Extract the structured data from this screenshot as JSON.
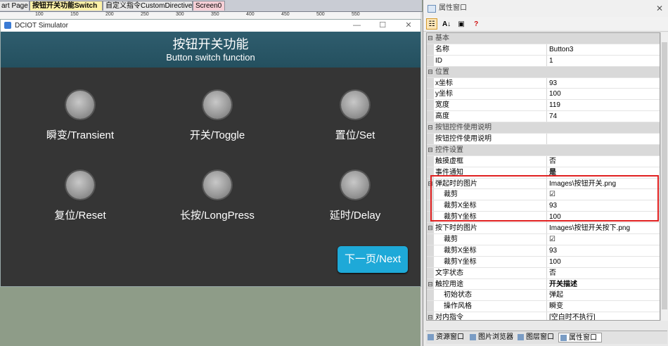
{
  "tabs": [
    {
      "label": "art Page"
    },
    {
      "label": "按钮开关功能Switch"
    },
    {
      "label": "自定义指令CustomDirectives"
    },
    {
      "label": "Screen0"
    }
  ],
  "ruler": [
    "100",
    "150",
    "200",
    "250",
    "300",
    "350",
    "400",
    "450",
    "500",
    "550"
  ],
  "simulator": {
    "title": "DCIOT Simulator",
    "min": "—",
    "max": "☐",
    "close": "✕",
    "header_title": "按钮开关功能",
    "header_subtitle": "Button switch function",
    "buttons": [
      {
        "label": "瞬变/Transient"
      },
      {
        "label": "开关/Toggle"
      },
      {
        "label": "置位/Set"
      },
      {
        "label": "复位/Reset"
      },
      {
        "label": "长按/LongPress"
      },
      {
        "label": "延时/Delay"
      }
    ],
    "next_label": "下一页/Next"
  },
  "panel": {
    "title": "属性窗口",
    "close": "✕",
    "toolbar": {
      "categorized": "☷",
      "alpha": "A↓",
      "pages": "▣",
      "help": "?"
    },
    "rows": [
      {
        "type": "cat",
        "name": "基本"
      },
      {
        "type": "prop",
        "name": "名称",
        "value": "Button3"
      },
      {
        "type": "prop",
        "name": "ID",
        "value": "1"
      },
      {
        "type": "cat",
        "name": "位置"
      },
      {
        "type": "prop",
        "name": "x坐标",
        "value": "93"
      },
      {
        "type": "prop",
        "name": "y坐标",
        "value": "100"
      },
      {
        "type": "prop",
        "name": "宽度",
        "value": "119"
      },
      {
        "type": "prop",
        "name": "高度",
        "value": "74"
      },
      {
        "type": "cat",
        "name": "按钮控件使用说明"
      },
      {
        "type": "prop",
        "name": "按钮控件使用说明",
        "value": ""
      },
      {
        "type": "cat",
        "name": "控件设置"
      },
      {
        "type": "prop",
        "name": "触摸虚框",
        "value": "否"
      },
      {
        "type": "prop",
        "name": "事件通知",
        "value": "是",
        "bold": true
      },
      {
        "type": "group",
        "name": "弹起时的图片",
        "value": "Images\\按钮开关.png"
      },
      {
        "type": "sub",
        "name": "裁剪",
        "value": "☑"
      },
      {
        "type": "sub",
        "name": "裁剪X坐标",
        "value": "93"
      },
      {
        "type": "sub",
        "name": "裁剪Y坐标",
        "value": "100"
      },
      {
        "type": "group",
        "name": "按下时的图片",
        "value": "Images\\按钮开关按下.png"
      },
      {
        "type": "sub",
        "name": "裁剪",
        "value": "☑"
      },
      {
        "type": "sub",
        "name": "裁剪X坐标",
        "value": "93"
      },
      {
        "type": "sub",
        "name": "裁剪Y坐标",
        "value": "100"
      },
      {
        "type": "prop",
        "name": "文字状态",
        "value": "否"
      },
      {
        "type": "group",
        "name": "触控用途",
        "value": "开关描述",
        "bold": true
      },
      {
        "type": "sub",
        "name": "初始状态",
        "value": "弹起"
      },
      {
        "type": "sub",
        "name": "操作风格",
        "value": "瞬变"
      },
      {
        "type": "group",
        "name": "对内指令",
        "value": "[空白时不执行]"
      }
    ],
    "bottom_tabs": [
      {
        "label": "资源窗口"
      },
      {
        "label": "图片浏览器"
      },
      {
        "label": "图层窗口"
      },
      {
        "label": "属性窗口"
      }
    ]
  }
}
